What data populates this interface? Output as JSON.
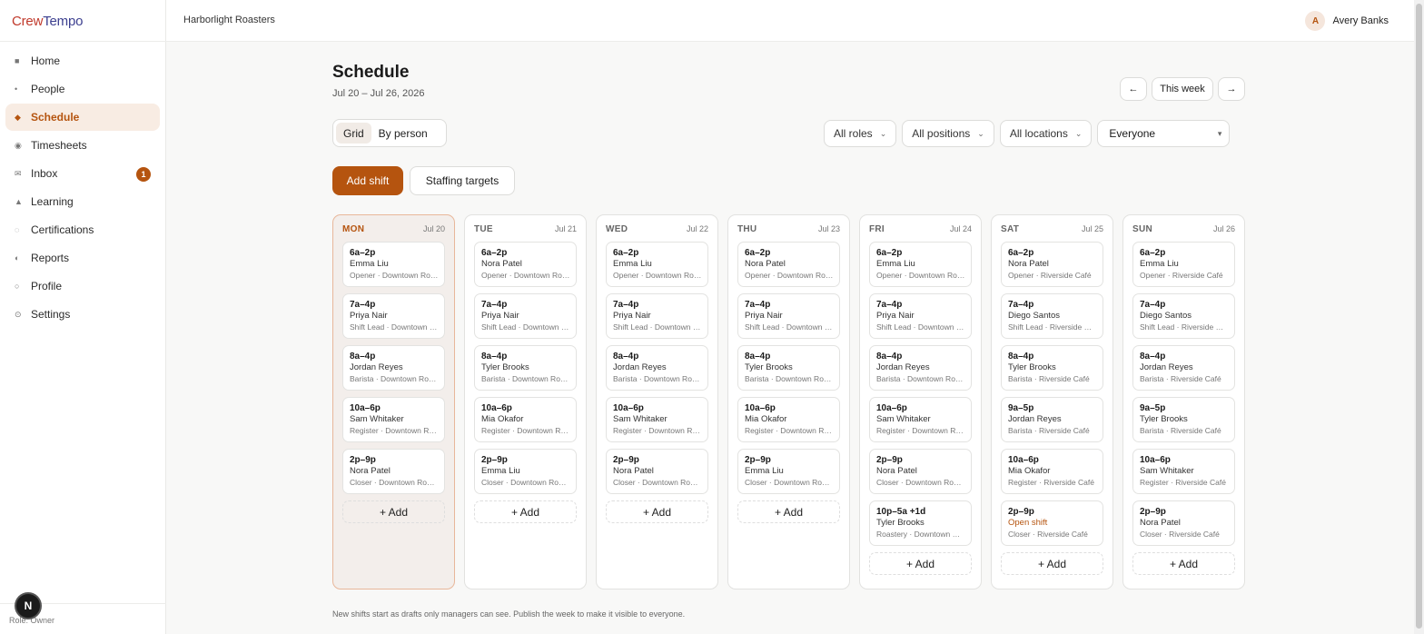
{
  "brand": {
    "part1": "Crew",
    "part2": "Tempo"
  },
  "sidebar": {
    "items": [
      {
        "label": "Home",
        "icon": "■"
      },
      {
        "label": "People",
        "icon": "•"
      },
      {
        "label": "Schedule",
        "icon": "◆"
      },
      {
        "label": "Timesheets",
        "icon": "◉"
      },
      {
        "label": "Inbox",
        "icon": "✉",
        "badge": "1"
      },
      {
        "label": "Learning",
        "icon": "▲"
      },
      {
        "label": "Certifications",
        "icon": "◌"
      },
      {
        "label": "Reports",
        "icon": "◐"
      },
      {
        "label": "Profile",
        "icon": "○"
      },
      {
        "label": "Settings",
        "icon": "⊙"
      }
    ],
    "role_label": "Role: Owner",
    "n_badge": "N"
  },
  "topbar": {
    "org": "Harborlight Roasters",
    "user_initial": "A",
    "user_name": "Avery Banks"
  },
  "header": {
    "title": "Schedule",
    "date_range": "Jul 20 – Jul 26, 2026"
  },
  "week_nav": {
    "prev": "←",
    "this_week": "This week",
    "next": "→"
  },
  "view_toggle": {
    "grid": "Grid",
    "by_person": "By person"
  },
  "filters": {
    "roles": "All roles",
    "positions": "All positions",
    "locations": "All locations",
    "people": "Everyone"
  },
  "actions": {
    "add_shift": "Add shift",
    "staffing_targets": "Staffing targets"
  },
  "add_label": "+ Add",
  "colors": {
    "accent": "#b5540f",
    "accent_light": "#f8ece3"
  },
  "days": [
    {
      "name": "MON",
      "date": "Jul 20",
      "shifts": [
        {
          "time": "6a–2p",
          "person": "Emma Liu",
          "meta": "Opener · Downtown Roastery"
        },
        {
          "time": "7a–4p",
          "person": "Priya Nair",
          "meta": "Shift Lead · Downtown Roastery"
        },
        {
          "time": "8a–4p",
          "person": "Jordan Reyes",
          "meta": "Barista · Downtown Roastery"
        },
        {
          "time": "10a–6p",
          "person": "Sam Whitaker",
          "meta": "Register · Downtown Roastery"
        },
        {
          "time": "2p–9p",
          "person": "Nora Patel",
          "meta": "Closer · Downtown Roastery"
        }
      ]
    },
    {
      "name": "TUE",
      "date": "Jul 21",
      "shifts": [
        {
          "time": "6a–2p",
          "person": "Nora Patel",
          "meta": "Opener · Downtown Roastery"
        },
        {
          "time": "7a–4p",
          "person": "Priya Nair",
          "meta": "Shift Lead · Downtown Roastery"
        },
        {
          "time": "8a–4p",
          "person": "Tyler Brooks",
          "meta": "Barista · Downtown Roastery"
        },
        {
          "time": "10a–6p",
          "person": "Mia Okafor",
          "meta": "Register · Downtown Roastery"
        },
        {
          "time": "2p–9p",
          "person": "Emma Liu",
          "meta": "Closer · Downtown Roastery"
        }
      ]
    },
    {
      "name": "WED",
      "date": "Jul 22",
      "shifts": [
        {
          "time": "6a–2p",
          "person": "Emma Liu",
          "meta": "Opener · Downtown Roastery"
        },
        {
          "time": "7a–4p",
          "person": "Priya Nair",
          "meta": "Shift Lead · Downtown Roastery"
        },
        {
          "time": "8a–4p",
          "person": "Jordan Reyes",
          "meta": "Barista · Downtown Roastery"
        },
        {
          "time": "10a–6p",
          "person": "Sam Whitaker",
          "meta": "Register · Downtown Roastery"
        },
        {
          "time": "2p–9p",
          "person": "Nora Patel",
          "meta": "Closer · Downtown Roastery"
        }
      ]
    },
    {
      "name": "THU",
      "date": "Jul 23",
      "shifts": [
        {
          "time": "6a–2p",
          "person": "Nora Patel",
          "meta": "Opener · Downtown Roastery"
        },
        {
          "time": "7a–4p",
          "person": "Priya Nair",
          "meta": "Shift Lead · Downtown Roastery"
        },
        {
          "time": "8a–4p",
          "person": "Tyler Brooks",
          "meta": "Barista · Downtown Roastery"
        },
        {
          "time": "10a–6p",
          "person": "Mia Okafor",
          "meta": "Register · Downtown Roastery"
        },
        {
          "time": "2p–9p",
          "person": "Emma Liu",
          "meta": "Closer · Downtown Roastery"
        }
      ]
    },
    {
      "name": "FRI",
      "date": "Jul 24",
      "shifts": [
        {
          "time": "6a–2p",
          "person": "Emma Liu",
          "meta": "Opener · Downtown Roastery"
        },
        {
          "time": "7a–4p",
          "person": "Priya Nair",
          "meta": "Shift Lead · Downtown Roastery"
        },
        {
          "time": "8a–4p",
          "person": "Jordan Reyes",
          "meta": "Barista · Downtown Roastery"
        },
        {
          "time": "10a–6p",
          "person": "Sam Whitaker",
          "meta": "Register · Downtown Roastery"
        },
        {
          "time": "2p–9p",
          "person": "Nora Patel",
          "meta": "Closer · Downtown Roastery"
        },
        {
          "time": "10p–5a +1d",
          "person": "Tyler Brooks",
          "meta": "Roastery · Downtown Roastery"
        }
      ]
    },
    {
      "name": "SAT",
      "date": "Jul 25",
      "shifts": [
        {
          "time": "6a–2p",
          "person": "Nora Patel",
          "meta": "Opener · Riverside Café"
        },
        {
          "time": "7a–4p",
          "person": "Diego Santos",
          "meta": "Shift Lead · Riverside Café"
        },
        {
          "time": "8a–4p",
          "person": "Tyler Brooks",
          "meta": "Barista · Riverside Café"
        },
        {
          "time": "9a–5p",
          "person": "Jordan Reyes",
          "meta": "Barista · Riverside Café"
        },
        {
          "time": "10a–6p",
          "person": "Mia Okafor",
          "meta": "Register · Riverside Café"
        },
        {
          "time": "2p–9p",
          "person": "Open shift",
          "meta": "Closer · Riverside Café",
          "open": true
        }
      ]
    },
    {
      "name": "SUN",
      "date": "Jul 26",
      "shifts": [
        {
          "time": "6a–2p",
          "person": "Emma Liu",
          "meta": "Opener · Riverside Café"
        },
        {
          "time": "7a–4p",
          "person": "Diego Santos",
          "meta": "Shift Lead · Riverside Café"
        },
        {
          "time": "8a–4p",
          "person": "Jordan Reyes",
          "meta": "Barista · Riverside Café"
        },
        {
          "time": "9a–5p",
          "person": "Tyler Brooks",
          "meta": "Barista · Riverside Café"
        },
        {
          "time": "10a–6p",
          "person": "Sam Whitaker",
          "meta": "Register · Riverside Café"
        },
        {
          "time": "2p–9p",
          "person": "Nora Patel",
          "meta": "Closer · Riverside Café"
        }
      ]
    }
  ],
  "footnote": "New shifts start as drafts only managers can see. Publish the week to make it visible to everyone."
}
